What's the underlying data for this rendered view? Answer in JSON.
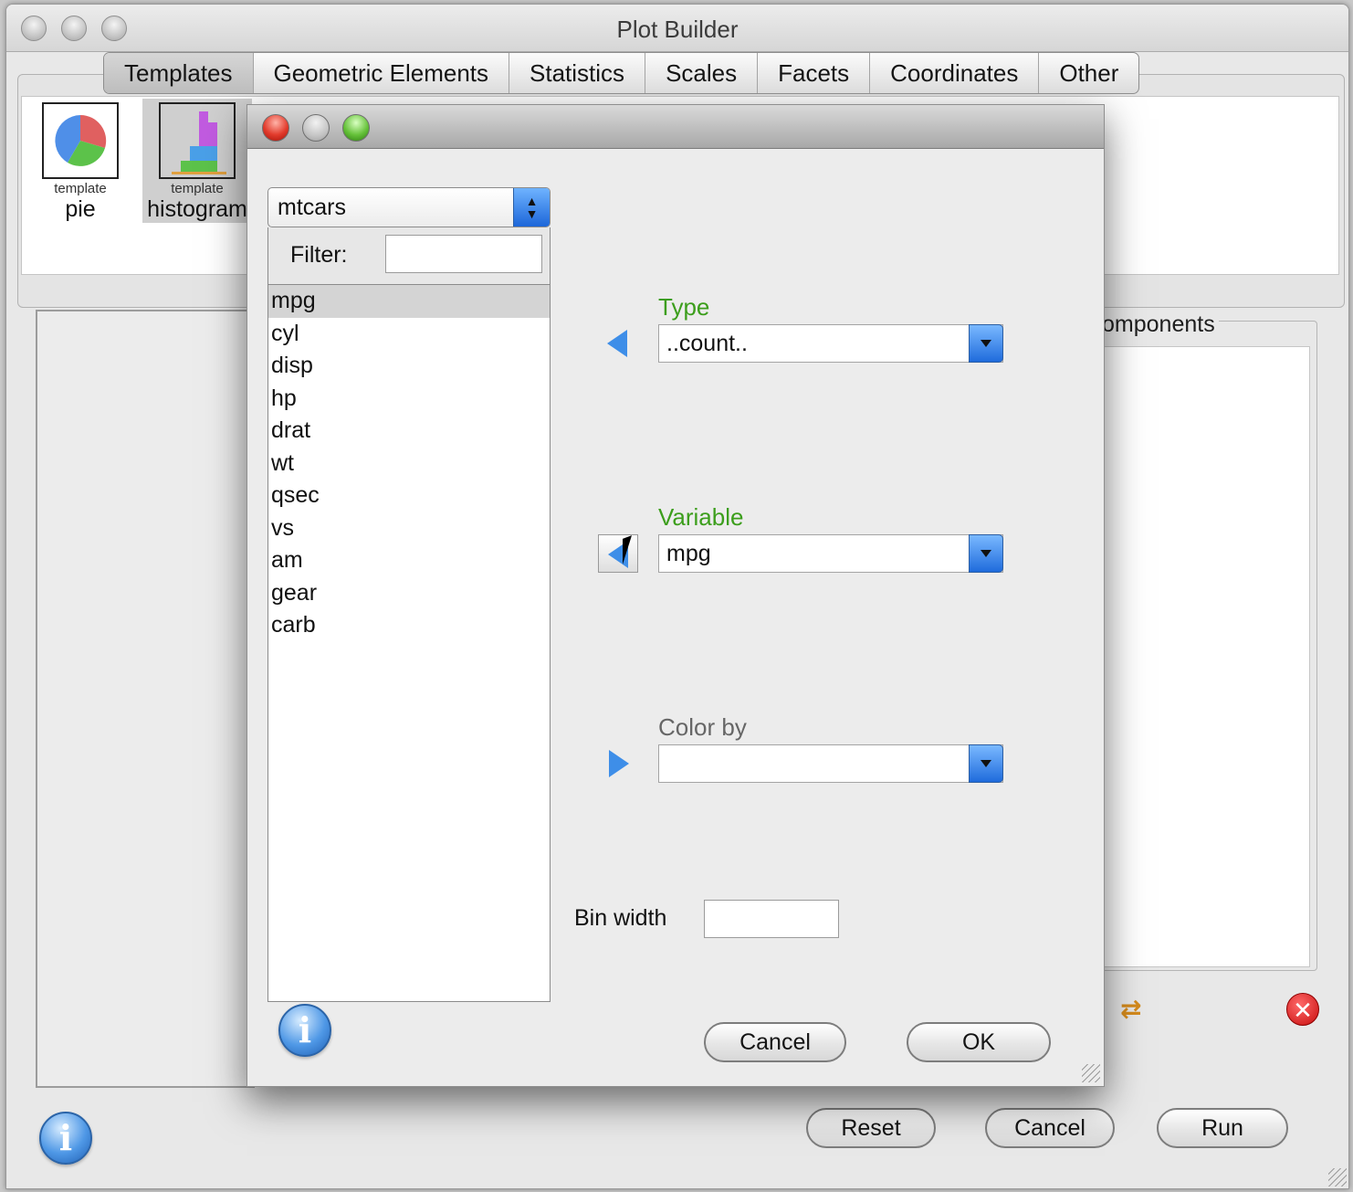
{
  "window": {
    "title": "Plot Builder"
  },
  "tabs": [
    "Templates",
    "Geometric Elements",
    "Statistics",
    "Scales",
    "Facets",
    "Coordinates",
    "Other"
  ],
  "templates": [
    {
      "small": "template",
      "name": "pie"
    },
    {
      "small": "template",
      "name": "histogram"
    }
  ],
  "components_label": "omponents",
  "main_buttons": {
    "reset": "Reset",
    "cancel": "Cancel",
    "run": "Run"
  },
  "dialog": {
    "dataset": "mtcars",
    "filter_label": "Filter:",
    "filter_value": "",
    "variables": [
      "mpg",
      "cyl",
      "disp",
      "hp",
      "drat",
      "wt",
      "qsec",
      "vs",
      "am",
      "gear",
      "carb"
    ],
    "selected_variable": "mpg",
    "type_label": "Type",
    "type_value": "..count..",
    "variable_label": "Variable",
    "variable_value": "mpg",
    "colorby_label": "Color by",
    "colorby_value": "",
    "binwidth_label": "Bin width",
    "binwidth_value": "",
    "cancel": "Cancel",
    "ok": "OK"
  },
  "colors": {
    "accent_green": "#3c9e1c",
    "accent_blue": "#3e8ee8",
    "close_red": "#e23b2c"
  }
}
